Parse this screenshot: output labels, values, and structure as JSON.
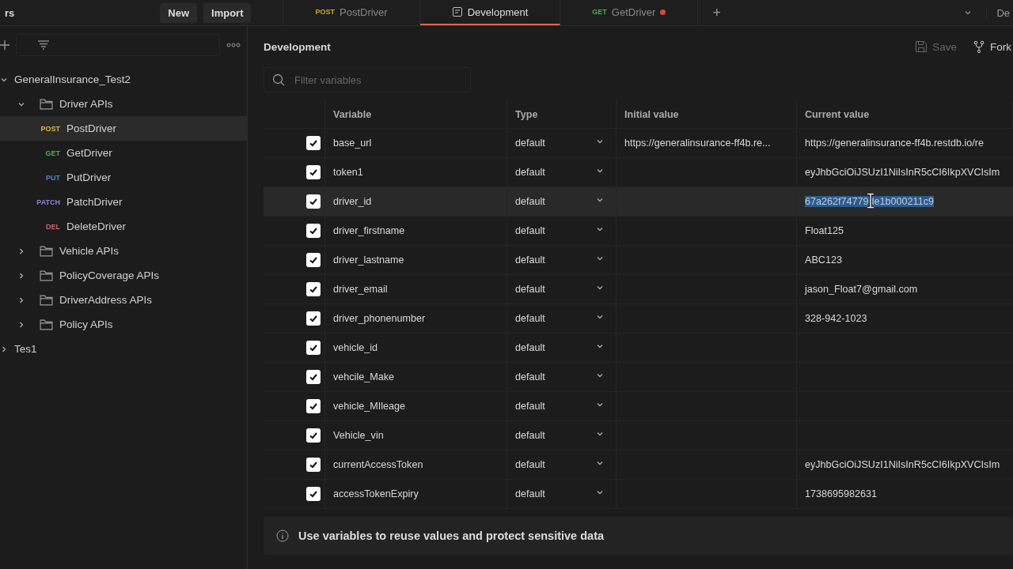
{
  "top_bar": {
    "left_fragment": "rs",
    "buttons": [
      "New",
      "Import"
    ],
    "tabs": [
      {
        "kind": "request",
        "method": "POST",
        "color": "#c9a43a",
        "label": "PostDriver",
        "selected": false,
        "unsaved": false
      },
      {
        "kind": "environment",
        "label": "Development",
        "selected": true,
        "unsaved": false
      },
      {
        "kind": "request",
        "method": "GET",
        "color": "#4caf50",
        "label": "GetDriver",
        "selected": false,
        "unsaved": true
      }
    ],
    "new_tab": "+",
    "right_fragment": "De"
  },
  "sidebar": {
    "tree": [
      {
        "kind": "collection",
        "label": "GeneralInsurance_Test2",
        "expanded": true,
        "children": [
          {
            "kind": "folder",
            "label": "Driver APIs",
            "expanded": true,
            "children": [
              {
                "kind": "request",
                "method": "POST",
                "color": "#d9b73c",
                "label": "PostDriver",
                "selected": true
              },
              {
                "kind": "request",
                "method": "GET",
                "color": "#4caf50",
                "label": "GetDriver",
                "selected": false
              },
              {
                "kind": "request",
                "method": "PUT",
                "color": "#4a86d6",
                "label": "PutDriver",
                "selected": false
              },
              {
                "kind": "request",
                "method": "PATCH",
                "color": "#8f7fd6",
                "label": "PatchDriver",
                "selected": false
              },
              {
                "kind": "request",
                "method": "DEL",
                "color": "#d06565",
                "label": "DeleteDriver",
                "selected": false
              }
            ]
          },
          {
            "kind": "folder",
            "label": "Vehicle APIs",
            "expanded": false
          },
          {
            "kind": "folder",
            "label": "PolicyCoverage APIs",
            "expanded": false
          },
          {
            "kind": "folder",
            "label": "DriverAddress APIs",
            "expanded": false
          },
          {
            "kind": "folder",
            "label": "Policy APIs",
            "expanded": false
          }
        ]
      },
      {
        "kind": "collection",
        "label": "Tes1",
        "expanded": false
      }
    ]
  },
  "environment": {
    "title": "Development",
    "actions": [
      {
        "kind": "save",
        "label": "Save",
        "disabled": true
      },
      {
        "kind": "fork",
        "label": "Fork",
        "disabled": false
      }
    ],
    "filter": {
      "placeholder": "Filter variables"
    },
    "table": {
      "columns": [
        "Variable",
        "Type",
        "Initial value",
        "Current value"
      ],
      "rows": [
        {
          "checked": true,
          "variable": "base_url",
          "type": "default",
          "initial_value": "https://generalinsurance-ff4b.re...",
          "current_value": "https://generalinsurance-ff4b.restdb.io/re",
          "highlighted": false
        },
        {
          "checked": true,
          "variable": "token1",
          "type": "default",
          "current_value": "eyJhbGciOiJSUzI1NiIsInR5cCI6IkpXVCIsIm",
          "highlighted": false
        },
        {
          "checked": true,
          "variable": "driver_id",
          "type": "default",
          "current_value": "67a262f74779de1b000211c9",
          "highlighted": true
        },
        {
          "checked": true,
          "variable": "driver_firstname",
          "type": "default",
          "current_value": "Float125",
          "highlighted": false
        },
        {
          "checked": true,
          "variable": "driver_lastname",
          "type": "default",
          "current_value": "ABC123",
          "highlighted": false
        },
        {
          "checked": true,
          "variable": "driver_email",
          "type": "default",
          "current_value": "jason_Float7@gmail.com",
          "highlighted": false
        },
        {
          "checked": true,
          "variable": "driver_phonenumber",
          "type": "default",
          "current_value": "328-942-1023",
          "highlighted": false
        },
        {
          "checked": true,
          "variable": "vehicle_id",
          "type": "default",
          "highlighted": false
        },
        {
          "checked": true,
          "variable": "vehcile_Make",
          "type": "default",
          "highlighted": false
        },
        {
          "checked": true,
          "variable": "vehicle_MIleage",
          "type": "default",
          "highlighted": false
        },
        {
          "checked": true,
          "variable": "Vehicle_vin",
          "type": "default",
          "highlighted": false
        },
        {
          "checked": true,
          "variable": "currentAccessToken",
          "type": "default",
          "current_value": "eyJhbGciOiJSUzI1NiIsInR5cCI6IkpXVCIsIm",
          "highlighted": false
        },
        {
          "checked": true,
          "variable": "accessTokenExpiry",
          "type": "default",
          "current_value": "1738695982631",
          "highlighted": false
        }
      ]
    },
    "info": {
      "title": "Use variables to reuse values and protect sensitive data"
    }
  }
}
